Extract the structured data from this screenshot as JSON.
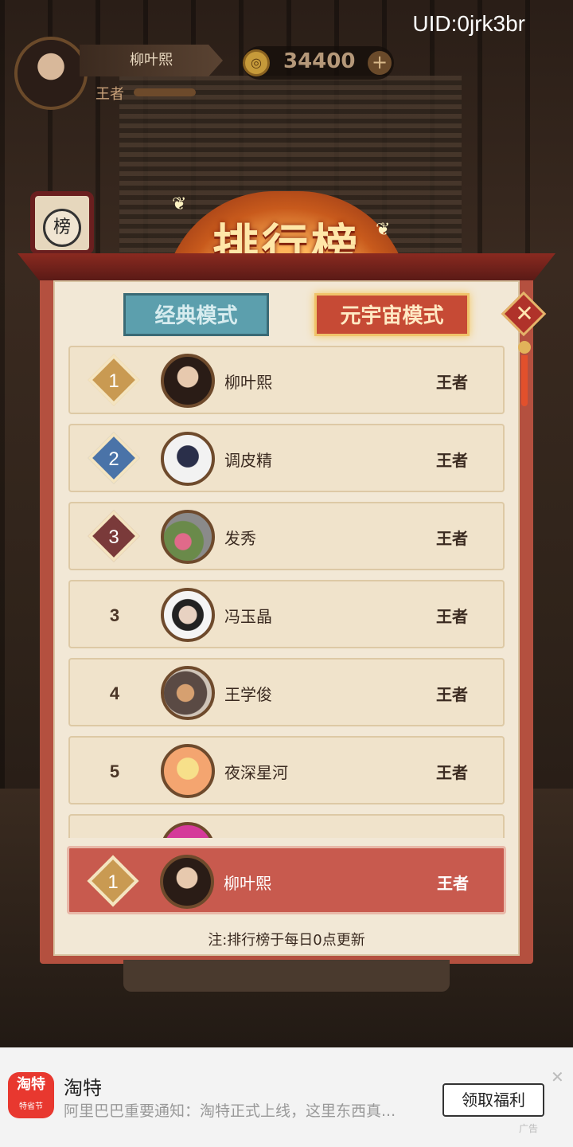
{
  "uid": "UID:0jrk3br",
  "player": {
    "name": "柳叶熙",
    "rank": "王者",
    "coins": "34400"
  },
  "side_badge": "榜",
  "title": "排行榜",
  "tabs": [
    {
      "label": "经典模式",
      "active": false
    },
    {
      "label": "元宇宙模式",
      "active": true
    }
  ],
  "colors": {
    "gold": "#e2b35a",
    "silver": "#4a73a8",
    "bronze": "#7a3a3a",
    "highlight": "#c85a4e"
  },
  "rows": [
    {
      "rank": "1",
      "name": "柳叶熙",
      "level": "王者",
      "badge": "gold"
    },
    {
      "rank": "2",
      "name": "调皮精",
      "level": "王者",
      "badge": "silver"
    },
    {
      "rank": "3",
      "name": "发秀",
      "level": "王者",
      "badge": "bronze"
    },
    {
      "rank": "3",
      "name": "冯玉晶",
      "level": "王者"
    },
    {
      "rank": "4",
      "name": "王学俊",
      "level": "王者"
    },
    {
      "rank": "5",
      "name": "夜深星河",
      "level": "王者"
    }
  ],
  "me": {
    "rank": "1",
    "name": "柳叶熙",
    "level": "王者"
  },
  "note": "注:排行榜于每日0点更新",
  "ad": {
    "app_name": "淘特",
    "logo_text": "淘特",
    "logo_sub": "特省节",
    "description": "阿里巴巴重要通知：淘特正式上线，这里东西真...",
    "button": "领取福利",
    "tag": "广告"
  }
}
